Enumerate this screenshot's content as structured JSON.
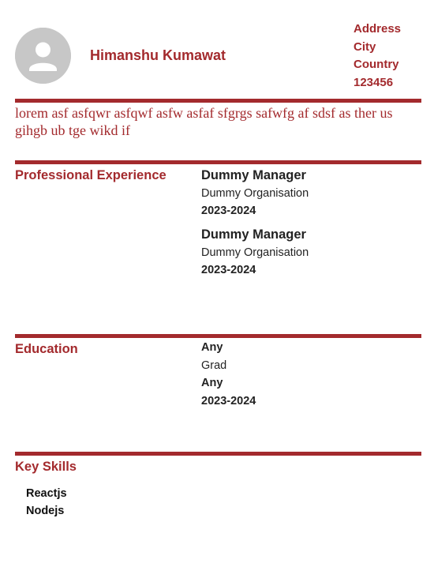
{
  "header": {
    "name": "Himanshu Kumawat",
    "address": [
      "Address",
      "City",
      "Country",
      "123456"
    ]
  },
  "summary": "lorem asf asfqwr asfqwf asfw asfaf sfgrgs safwfg af sdsf as ther us gihgb ub tge wikd if",
  "experience": {
    "title": "Professional Experience",
    "items": [
      {
        "role": "Dummy Manager",
        "organisation": "Dummy Organisation",
        "years": "2023-2024"
      },
      {
        "role": "Dummy Manager",
        "organisation": "Dummy Organisation",
        "years": "2023-2024"
      }
    ]
  },
  "education": {
    "title": "Education",
    "lines": [
      "Any",
      "Grad",
      "Any",
      "2023-2024"
    ]
  },
  "skills": {
    "title": "Key Skills",
    "items": [
      "Reactjs",
      "Nodejs"
    ]
  },
  "colors": {
    "accent": "#a32a2d",
    "avatar_bg": "#c7c7c7",
    "text": "#222222"
  },
  "icons": {
    "avatar": "user-placeholder-icon"
  }
}
